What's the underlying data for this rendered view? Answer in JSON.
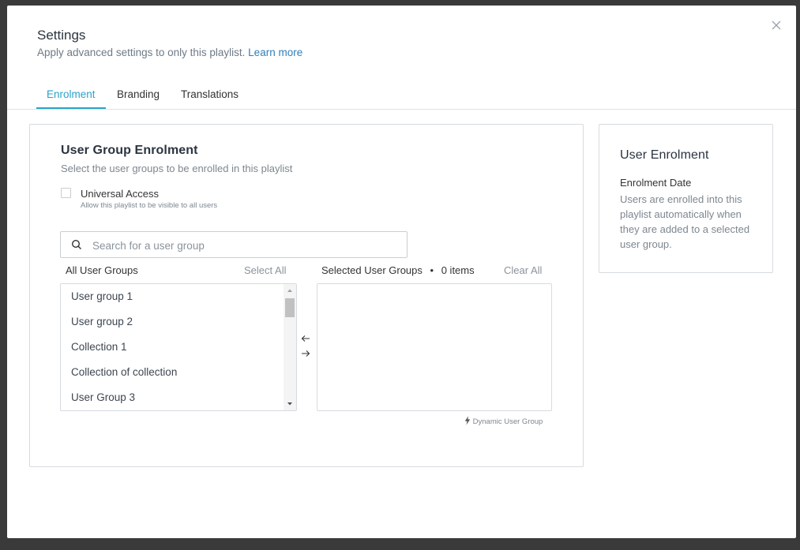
{
  "modal": {
    "title": "Settings",
    "subtitle": "Apply advanced settings to only this playlist.",
    "learn_more": "Learn more"
  },
  "tabs": [
    {
      "label": "Enrolment",
      "active": true
    },
    {
      "label": "Branding",
      "active": false
    },
    {
      "label": "Translations",
      "active": false
    }
  ],
  "user_group_enrolment": {
    "heading": "User Group Enrolment",
    "description": "Select the user groups to be enrolled in this playlist",
    "universal_access": {
      "label": "Universal Access",
      "hint": "Allow this playlist to be visible to all users",
      "checked": false
    },
    "search": {
      "placeholder": "Search for a user group",
      "value": ""
    },
    "all_groups": {
      "title": "All User Groups",
      "select_all": "Select All",
      "items": [
        "User group 1",
        "User group 2",
        "Collection 1",
        "Collection of collection",
        "User Group 3"
      ]
    },
    "selected_groups": {
      "title": "Selected User Groups",
      "separator": "•",
      "count_label": "0 items",
      "clear_all": "Clear All",
      "items": []
    },
    "dynamic_user_group": "Dynamic User Group"
  },
  "user_enrolment": {
    "heading": "User Enrolment",
    "subheading": "Enrolment Date",
    "text": "Users are enrolled into this playlist automatically when they are added to a selected user group."
  },
  "colors": {
    "accent": "#2aa3c9",
    "link": "#2f7fb8",
    "overlay": "#3a3a3a"
  }
}
